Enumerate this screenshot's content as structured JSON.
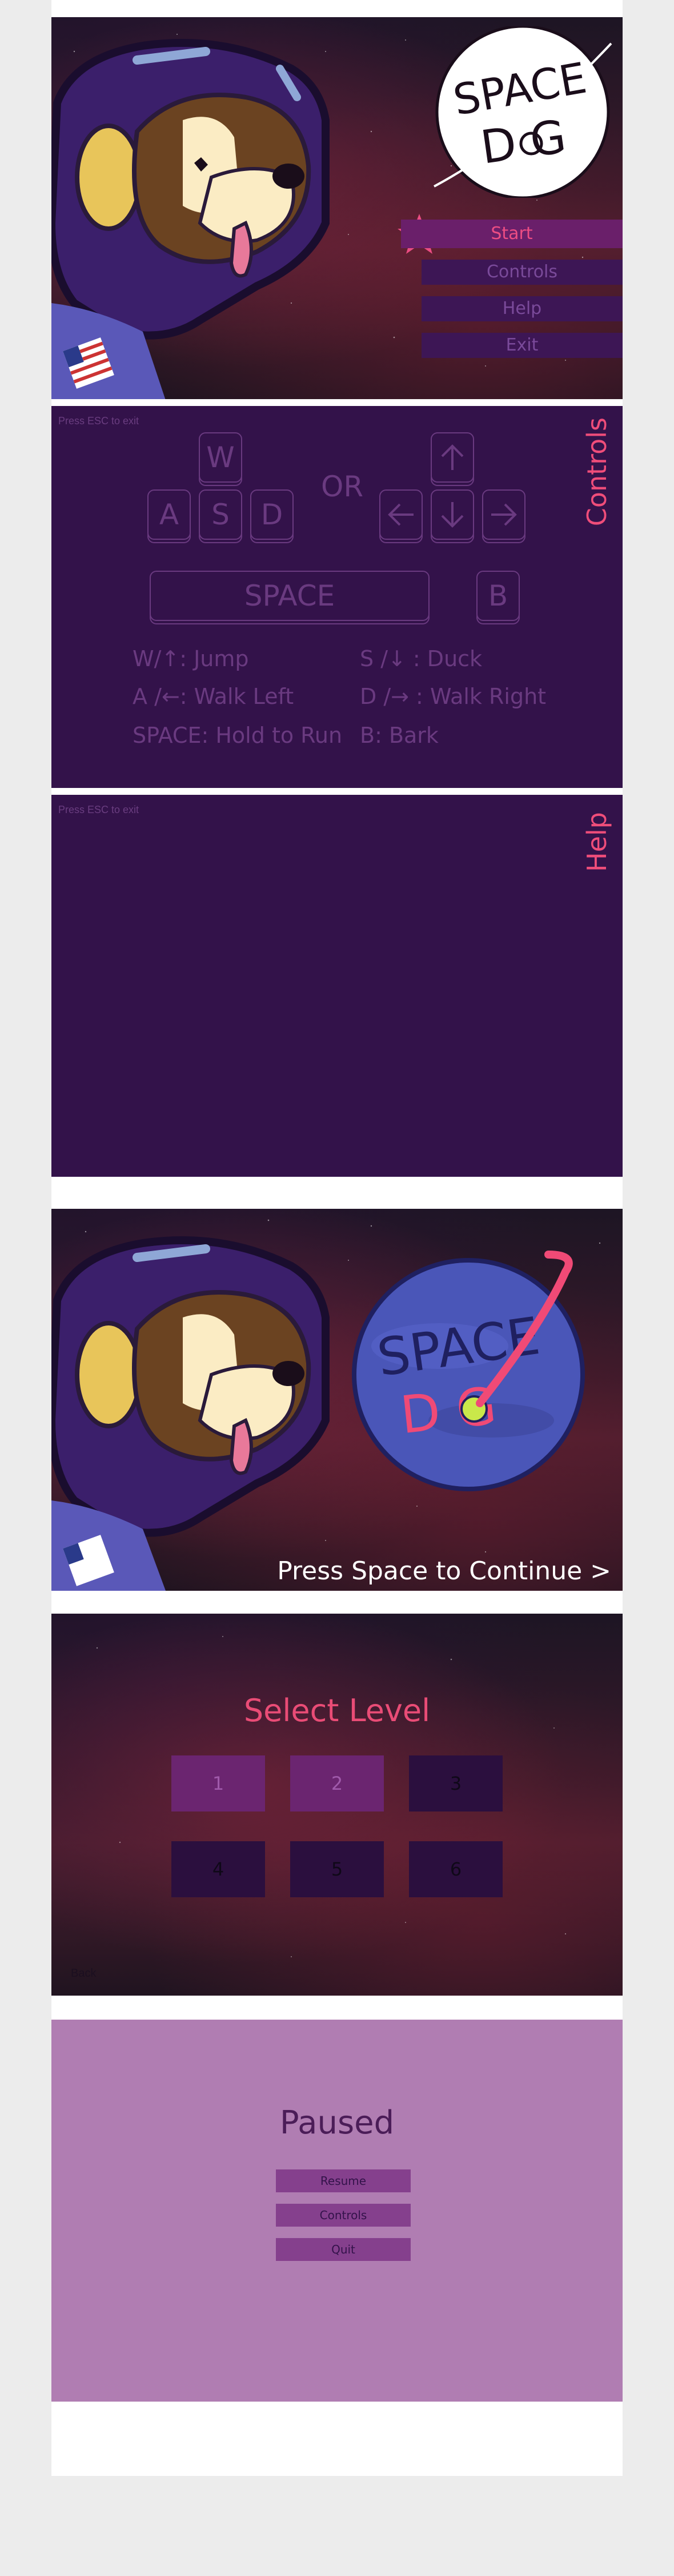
{
  "main_menu": {
    "logo_text": "SPACE DOG",
    "buttons": [
      "Start",
      "Controls",
      "Help",
      "Exit"
    ],
    "star_icon": "star-icon",
    "colors": {
      "accent": "#ec4d83",
      "button_bg": "#3d1655",
      "button_text": "#7a4a9a"
    }
  },
  "controls": {
    "esc_hint": "Press ESC to exit",
    "title": "Controls",
    "keys_letters": [
      "W",
      "A",
      "S",
      "D"
    ],
    "or_text": "OR",
    "space_key": "SPACE",
    "b_key": "B",
    "legend": {
      "jump": "W/↑: Jump",
      "duck": "S /↓ : Duck",
      "walk_left": "A /←: Walk Left",
      "walk_right": "D /→ : Walk Right",
      "run": "SPACE: Hold to Run",
      "bark": "B: Bark"
    }
  },
  "help": {
    "esc_hint": "Press ESC to exit",
    "title": "Help"
  },
  "splash": {
    "continue_text": "Press Space to Continue >"
  },
  "level_select": {
    "title": "Select Level",
    "levels": [
      "1",
      "2",
      "3",
      "4",
      "5",
      "6"
    ],
    "back": "Back"
  },
  "pause": {
    "title": "Paused",
    "buttons": [
      "Resume",
      "Controls",
      "Quit"
    ]
  }
}
